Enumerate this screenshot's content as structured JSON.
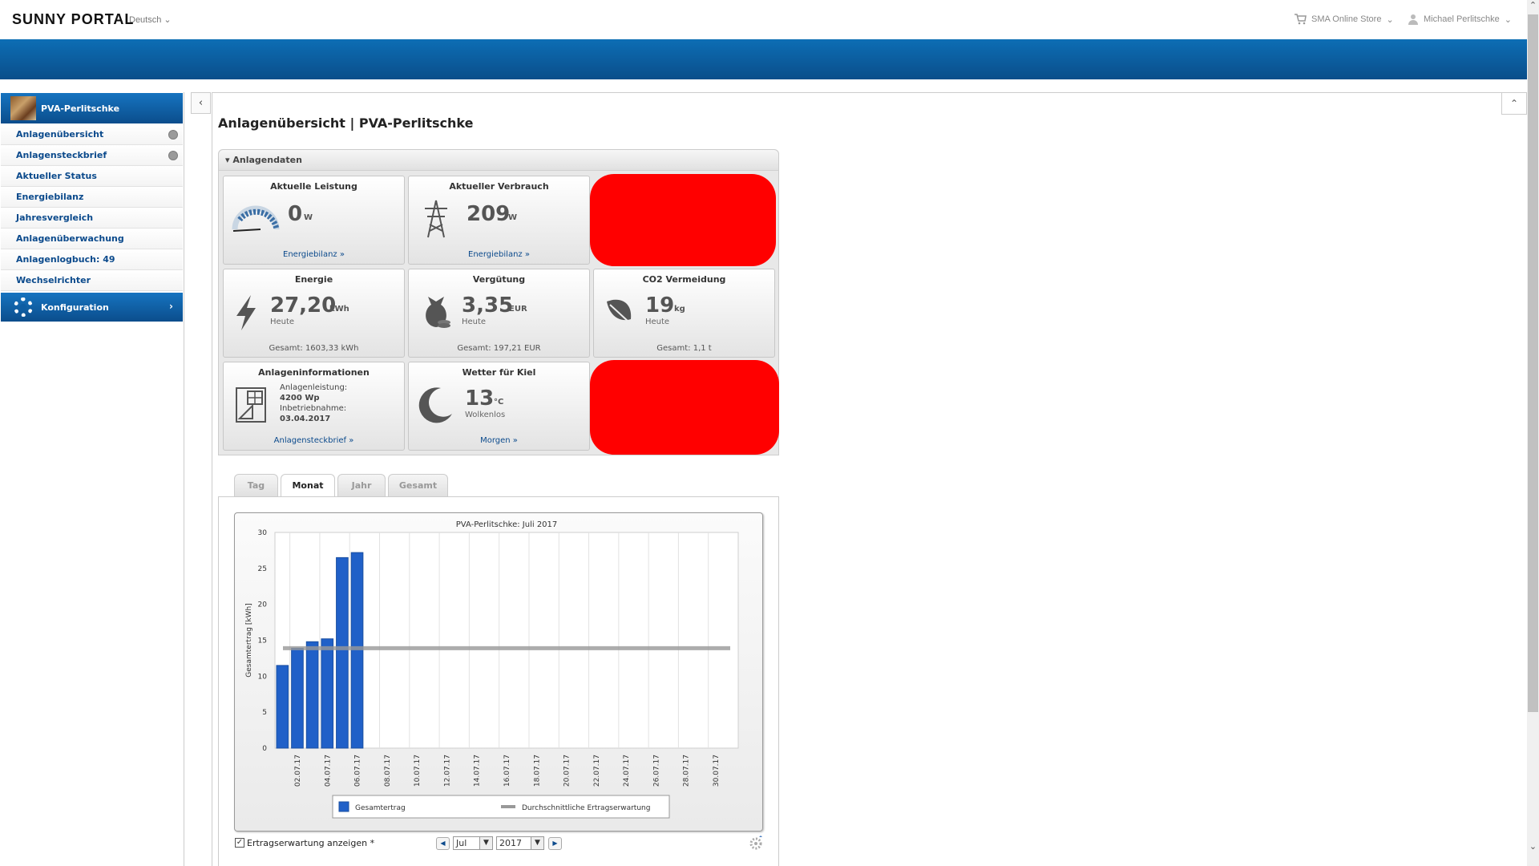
{
  "header": {
    "logo": "SUNNY PORTAL",
    "language": "Deutsch",
    "store": "SMA Online Store",
    "user": "Michael Perlitschke"
  },
  "sidebar": {
    "plant_name": "PVA-Perlitschke",
    "items": [
      {
        "label": "Anlagenübersicht",
        "icon": "globe-icon"
      },
      {
        "label": "Anlagensteckbrief",
        "icon": "globe-icon"
      },
      {
        "label": "Aktueller Status"
      },
      {
        "label": "Energiebilanz"
      },
      {
        "label": "Jahresvergleich"
      },
      {
        "label": "Anlagenüberwachung"
      },
      {
        "label": "Anlagenlogbuch: 49"
      },
      {
        "label": "Wechselrichter"
      }
    ],
    "config_label": "Konfiguration"
  },
  "page": {
    "title": "Anlagenübersicht | PVA-Perlitschke",
    "panel_title": "Anlagendaten"
  },
  "tiles": {
    "power": {
      "title": "Aktuelle Leistung",
      "value": "0",
      "unit": "W",
      "link": "Energiebilanz »"
    },
    "consumption": {
      "title": "Aktueller Verbrauch",
      "value": "209",
      "unit": "W",
      "link": "Energiebilanz »"
    },
    "energy": {
      "title": "Energie",
      "value": "27,20",
      "unit": "kWh",
      "sub": "Heute",
      "foot": "Gesamt: 1603,33 kWh"
    },
    "revenue": {
      "title": "Vergütung",
      "value": "3,35",
      "unit": "EUR",
      "sub": "Heute",
      "foot": "Gesamt: 197,21 EUR"
    },
    "co2": {
      "title": "CO2 Vermeidung",
      "value": "19",
      "unit": "kg",
      "sub": "Heute",
      "foot": "Gesamt: 1,1 t"
    },
    "info": {
      "title": "Anlageninformationen",
      "power_label": "Anlagenleistung:",
      "power_value": "4200 Wp",
      "start_label": "Inbetriebnahme:",
      "start_value": "03.04.2017",
      "link": "Anlagensteckbrief »"
    },
    "weather": {
      "title": "Wetter für Kiel",
      "value": "13",
      "unit": "°C",
      "sub": "Wolkenlos",
      "link": "Morgen »"
    }
  },
  "tabs": [
    "Tag",
    "Monat",
    "Jahr",
    "Gesamt"
  ],
  "active_tab": "Monat",
  "controls": {
    "checkbox_label": "Ertragserwartung anzeigen *",
    "checkbox_mark": "✓",
    "month": "Jul",
    "year": "2017"
  },
  "chart_data": {
    "type": "bar",
    "title": "PVA-Perlitschke: Juli 2017",
    "ylabel": "Gesamtertrag [kWh]",
    "xlabel": "",
    "ylim": [
      0,
      30
    ],
    "yticks": [
      0,
      5,
      10,
      15,
      20,
      25,
      30
    ],
    "x_tick_labels": [
      "02.07.17",
      "04.07.17",
      "06.07.17",
      "08.07.17",
      "10.07.17",
      "12.07.17",
      "14.07.17",
      "16.07.17",
      "18.07.17",
      "20.07.17",
      "22.07.17",
      "24.07.17",
      "26.07.17",
      "28.07.17",
      "30.07.17"
    ],
    "days": 31,
    "series": [
      {
        "name": "Gesamtertrag",
        "color": "#2060c8",
        "values": [
          11.5,
          13.9,
          14.8,
          15.2,
          26.5,
          27.2
        ]
      },
      {
        "name": "Durchschnittliche Ertragserwartung",
        "color": "#999999",
        "type": "line",
        "value": 13.9
      }
    ],
    "grid": true,
    "legend": "bottom"
  }
}
